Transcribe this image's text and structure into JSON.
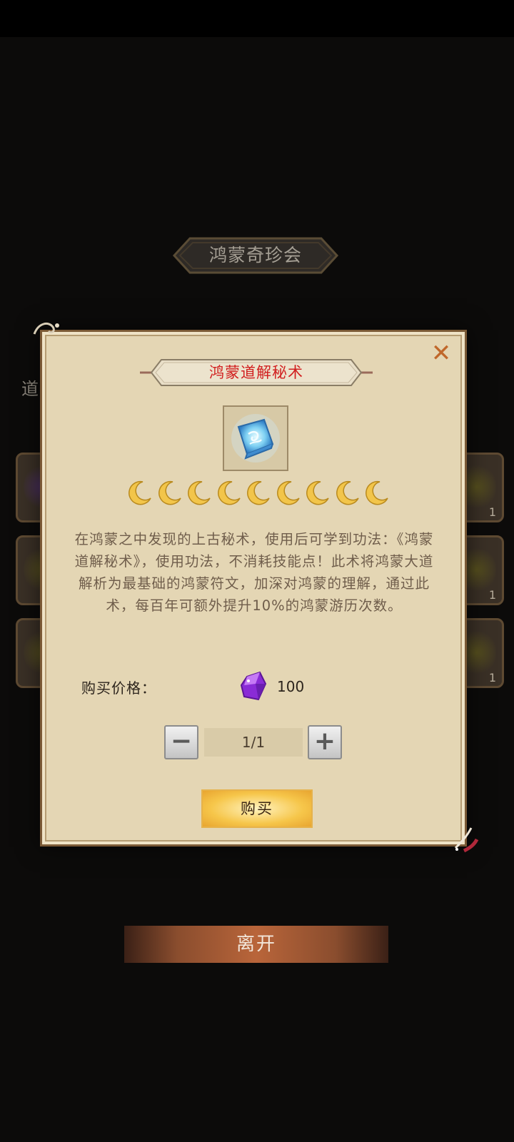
{
  "shop": {
    "title": "鸿蒙奇珍会",
    "partial_label": "道"
  },
  "side_cards": {
    "counts": [
      "1",
      "1",
      "1"
    ]
  },
  "dialog": {
    "item_name": "鸿蒙道解秘术",
    "item_icon": "glowing-blue-book-icon",
    "moon_icon": "crescent-moon-icon",
    "moon_count": 9,
    "description": "在鸿蒙之中发现的上古秘术，使用后可学到功法：《鸿蒙道解秘术》，使用功法，不消耗技能点！此术将鸿蒙大道解析为最基础的鸿蒙符文，加深对鸿蒙的理解，通过此术，每百年可额外提升10%的鸿蒙游历次数。",
    "price_label": "购买价格：",
    "currency_icon": "purple-gem-icon",
    "price_value": "100",
    "quantity": "1/1",
    "buy_label": "购买"
  },
  "leave_label": "离开",
  "colors": {
    "item_name": "#d11f1f",
    "dialog_bg": "#e4d6b4",
    "buy_button": "#f6c64a",
    "close_icon": "#c0672a"
  }
}
